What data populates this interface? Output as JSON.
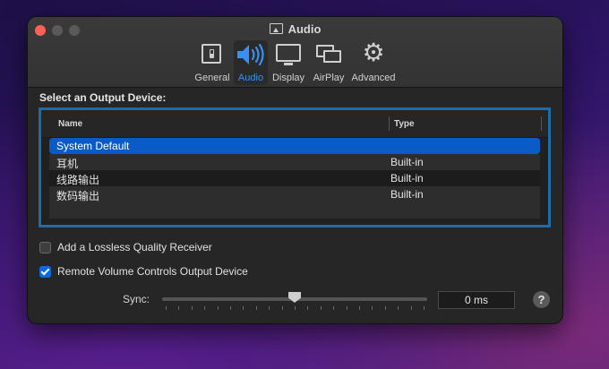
{
  "window": {
    "title": "Audio"
  },
  "toolbar": {
    "tabs": [
      {
        "id": "general",
        "label": "General",
        "icon": "general-switch-icon"
      },
      {
        "id": "audio",
        "label": "Audio",
        "icon": "speaker-icon",
        "active": true
      },
      {
        "id": "display",
        "label": "Display",
        "icon": "display-icon"
      },
      {
        "id": "airplay",
        "label": "AirPlay",
        "icon": "airplay-icon"
      },
      {
        "id": "advanced",
        "label": "Advanced",
        "icon": "gear-icon"
      }
    ]
  },
  "output": {
    "section_label": "Select an Output Device:",
    "columns": {
      "name": "Name",
      "type": "Type"
    },
    "rows": [
      {
        "name": "System Default",
        "type": "",
        "selected": true
      },
      {
        "name": "耳机",
        "type": "Built-in"
      },
      {
        "name": "线路输出",
        "type": "Built-in"
      },
      {
        "name": "数码输出",
        "type": "Built-in"
      }
    ]
  },
  "options": {
    "lossless": {
      "label": "Add a Lossless Quality Receiver",
      "checked": false
    },
    "remote_volume": {
      "label": "Remote Volume Controls Output Device",
      "checked": true
    }
  },
  "sync": {
    "label": "Sync:",
    "value": "0 ms",
    "slider_fraction": 0.5
  },
  "help": {
    "label": "?"
  },
  "colors": {
    "accent": "#0a5bc8",
    "selection_border": "#1f6ca8",
    "close": "#fe5f57"
  }
}
